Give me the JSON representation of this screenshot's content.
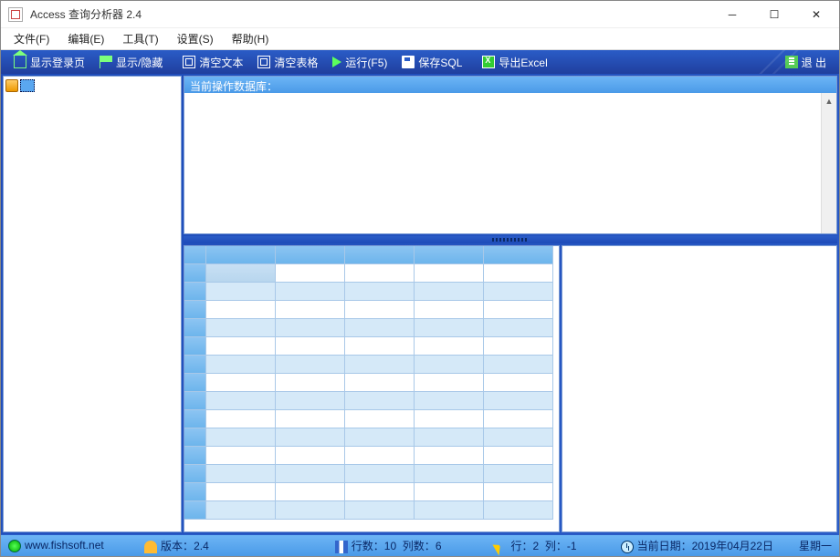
{
  "title": "Access 查询分析器 2.4",
  "menus": {
    "file": "文件(F)",
    "edit": "编辑(E)",
    "tool": "工具(T)",
    "setting": "设置(S)",
    "help": "帮助(H)"
  },
  "toolbar": {
    "show_login": "显示登录页",
    "show_hide": "显示/隐藏",
    "clear_text": "清空文本",
    "clear_grid": "清空表格",
    "run": "运行(F5)",
    "save_sql": "保存SQL",
    "export_excel": "导出Excel",
    "exit": "退 出"
  },
  "caption": "当前操作数据库：",
  "status": {
    "url": "www.fishsoft.net",
    "version_label": "版本：",
    "version": "2.4",
    "rows_label": "行数：",
    "rows": "10",
    "cols_label": "列数：",
    "cols": "6",
    "line_label": "行：",
    "line": "2",
    "col_label": "列：",
    "col": "-1",
    "date_label": "当前日期：",
    "date": "2019年04月22日",
    "weekday": "星期一"
  },
  "chart_data": {
    "type": "table",
    "columns": 6,
    "rows": 14,
    "headers": [
      "",
      "",
      "",
      "",
      "",
      ""
    ],
    "data": []
  }
}
